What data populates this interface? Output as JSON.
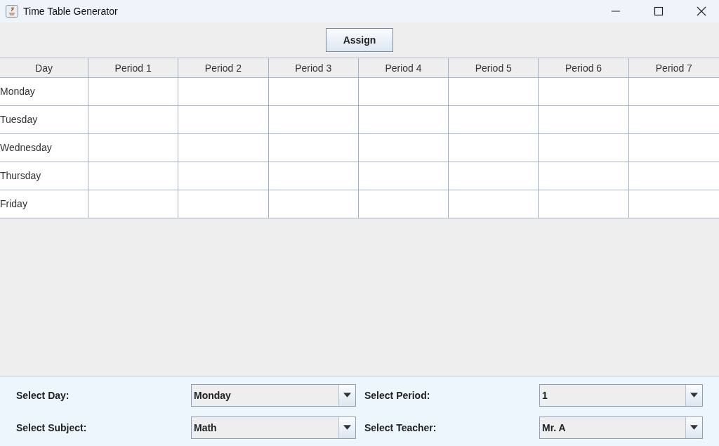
{
  "window": {
    "title": "Time Table Generator"
  },
  "assign_button": "Assign",
  "table": {
    "columns": [
      "Day",
      "Period 1",
      "Period 2",
      "Period 3",
      "Period 4",
      "Period 5",
      "Period 6",
      "Period 7"
    ],
    "rows": [
      {
        "day": "Monday"
      },
      {
        "day": "Tuesday"
      },
      {
        "day": "Wednesday"
      },
      {
        "day": "Thursday"
      },
      {
        "day": "Friday"
      }
    ]
  },
  "form": [
    {
      "label": "Select Day:",
      "value": "Monday"
    },
    {
      "label": "Select Period:",
      "value": "1"
    },
    {
      "label": "Select Subject:",
      "value": "Math"
    },
    {
      "label": "Select Teacher:",
      "value": "Mr. A"
    }
  ]
}
